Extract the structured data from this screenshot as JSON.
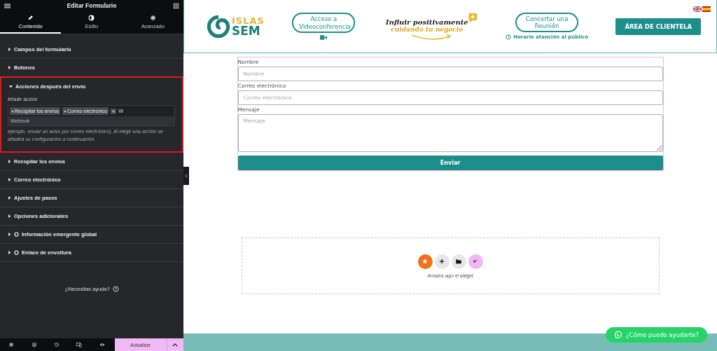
{
  "panel": {
    "title": "Editar Formulario",
    "tabs": [
      {
        "label": "Contenido",
        "selected": true
      },
      {
        "label": "Estilo",
        "selected": false
      },
      {
        "label": "Avanzado",
        "selected": false
      }
    ],
    "sections": [
      {
        "title": "Campos del formulario",
        "expanded": false,
        "pro": false,
        "highlighted": false
      },
      {
        "title": "Botones",
        "expanded": false,
        "pro": false,
        "highlighted": false
      },
      {
        "title": "Acciones después del envío",
        "expanded": true,
        "pro": false,
        "highlighted": true,
        "control": {
          "label": "Añadir acción",
          "tags": [
            "Recopilar los envíos",
            "Correo electrónico"
          ],
          "value": "W",
          "suggestion": "Webhook",
          "description": "ejemplo, enviar un aviso por correo electrónico). Al elegir una acción se añadirá su configuración a continuación."
        }
      },
      {
        "title": "Recopilar los envíos",
        "expanded": false,
        "pro": false,
        "highlighted": false
      },
      {
        "title": "Correo electrónico",
        "expanded": false,
        "pro": false,
        "highlighted": false
      },
      {
        "title": "Ajustes de pasos",
        "expanded": false,
        "pro": false,
        "highlighted": false
      },
      {
        "title": "Opciones adicionales",
        "expanded": false,
        "pro": false,
        "highlighted": false
      },
      {
        "title": "Información emergente global",
        "expanded": false,
        "pro": true,
        "highlighted": false
      },
      {
        "title": "Enlace de envoltura",
        "expanded": false,
        "pro": true,
        "highlighted": false
      }
    ],
    "help": "¿Necesitas ayuda?",
    "update_button": "Actualizar"
  },
  "preview": {
    "header": {
      "logo_top": "ISLAS",
      "logo_bottom": "SEM",
      "video_button": "Acceso a Videoconferencia",
      "slogan_top": "Influir positivamente",
      "slogan_bottom": "cuidando tu negocio",
      "meeting_button": "Concertar una Reunión",
      "hours_link": "Horario atención al público",
      "client_button": "ÁREA DE CLIENTELA"
    },
    "form": {
      "fields": [
        {
          "kind": "input",
          "label": "Nombre",
          "placeholder": "Nombre"
        },
        {
          "kind": "input",
          "label": "Correo electrónico",
          "placeholder": "Correo electrónico"
        },
        {
          "kind": "textarea",
          "label": "Mensaje",
          "placeholder": "Mensaje"
        }
      ],
      "submit": "Enviar"
    },
    "dropzone": {
      "hint": "Arrastra aquí el widget"
    },
    "chat_button": "¿Cómo puedo ayudarte?"
  }
}
